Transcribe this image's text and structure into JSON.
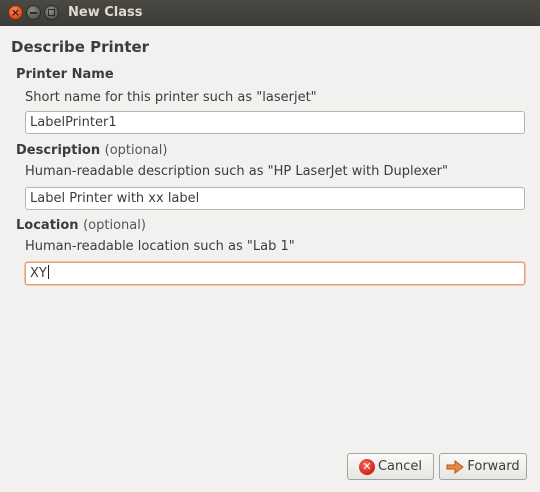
{
  "window": {
    "title": "New Class",
    "controls": {
      "close_glyph": "×",
      "minimize_icon": "minimize-icon",
      "maximize_icon": "maximize-icon"
    }
  },
  "page": {
    "heading": "Describe Printer"
  },
  "printer_name": {
    "label": "Printer Name",
    "hint": "Short name for this printer such as \"laserjet\"",
    "value": "LabelPrinter1"
  },
  "description": {
    "label": "Description",
    "optional": "(optional)",
    "hint": "Human-readable description such as \"HP LaserJet with Duplexer\"",
    "value": "Label Printer with xx label"
  },
  "location": {
    "label": "Location",
    "optional": "(optional)",
    "hint": "Human-readable location such as \"Lab 1\"",
    "value": "XY"
  },
  "buttons": {
    "cancel_label": "Cancel",
    "cancel_icon": "cancel-icon",
    "forward_label": "Forward",
    "forward_icon": "forward-arrow-icon"
  },
  "colors": {
    "titlebar": "#3c3b37",
    "window_bg": "#f2f1ef",
    "focus_border": "#e2a07a",
    "forward_arrow": "#e07b39"
  }
}
